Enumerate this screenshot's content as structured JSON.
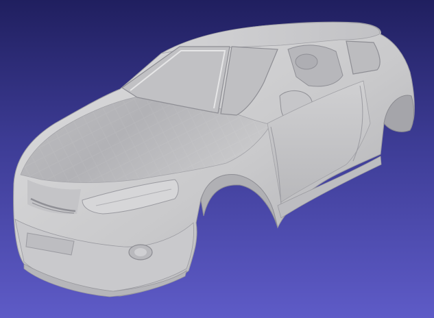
{
  "viewport": {
    "background_top": "#201f5f",
    "background_bottom": "#5e5bc7",
    "model_color": "#cfcfd1"
  },
  "model": {
    "object": "car-body-shell-mesh",
    "shading": "flat-faceted",
    "view": "three-quarter-front-left"
  }
}
